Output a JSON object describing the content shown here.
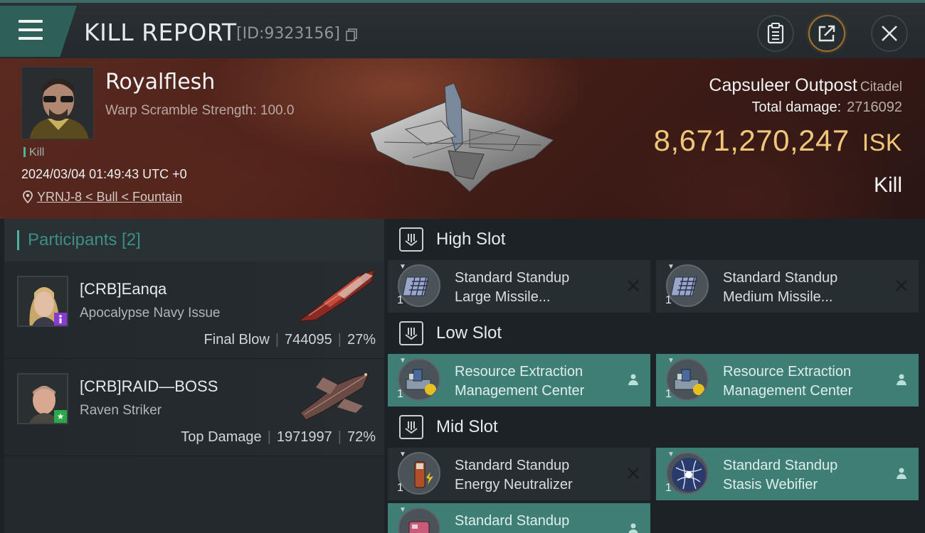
{
  "header": {
    "title": "KILL REPORT",
    "report_id": "[ID:9323156]",
    "icons": [
      "menu-icon",
      "copy-icon",
      "clipboard-icon",
      "share-icon",
      "close-icon"
    ]
  },
  "victim": {
    "name": "Royalflesh",
    "scramble": "Warp Scramble Strength: 100.0",
    "tag": "Kill",
    "datetime": "2024/03/04 01:49:43 UTC +0",
    "location": "YRNJ-8 < Bull < Fountain"
  },
  "target": {
    "name": "Capsuleer Outpost",
    "type": "Citadel",
    "total_damage_label": "Total damage:",
    "total_damage": "2716092",
    "isk_value": "8,671,270,247",
    "isk_unit": "ISK",
    "result": "Kill"
  },
  "participants": {
    "title": "Participants [2]",
    "items": [
      {
        "name": "[CRB]Eanqa",
        "ship": "Apocalypse Navy Issue",
        "role": "Final Blow",
        "damage": "744095",
        "percent": "27%"
      },
      {
        "name": "[CRB]RAID—BOSS",
        "ship": "Raven Striker",
        "role": "Top Damage",
        "damage": "1971997",
        "percent": "72%"
      }
    ]
  },
  "fitting": {
    "high": {
      "label": "High Slot",
      "modules": [
        {
          "line1": "Standard Standup",
          "line2": "Large Missile...",
          "qty": "1",
          "status": "destroyed"
        },
        {
          "line1": "Standard Standup",
          "line2": "Medium Missile...",
          "qty": "1",
          "status": "destroyed"
        }
      ]
    },
    "low": {
      "label": "Low Slot",
      "modules": [
        {
          "line1": "Resource Extraction",
          "line2": "Management Center",
          "qty": "1",
          "status": "dropped"
        },
        {
          "line1": "Resource Extraction",
          "line2": "Management Center",
          "qty": "1",
          "status": "dropped"
        }
      ]
    },
    "mid": {
      "label": "Mid Slot",
      "modules": [
        {
          "line1": "Standard Standup",
          "line2": "Energy Neutralizer",
          "qty": "1",
          "status": "destroyed"
        },
        {
          "line1": "Standard Standup",
          "line2": "Stasis Webifier",
          "qty": "1",
          "status": "dropped"
        }
      ]
    },
    "extra": {
      "modules": [
        {
          "line1": "Standard Standup",
          "status": "dropped"
        }
      ]
    }
  },
  "colors": {
    "accent": "#4fb3a2",
    "isk": "#f0c77a",
    "active_module": "#3e7e74"
  }
}
